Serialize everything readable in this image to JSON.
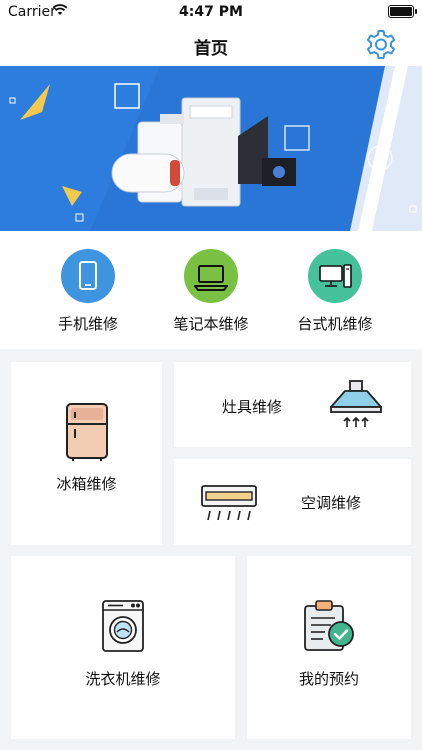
{
  "status_bar": {
    "carrier": "Carrier",
    "time": "4:47 PM"
  },
  "header": {
    "title": "首页"
  },
  "categories": [
    {
      "label": "手机维修",
      "color": "#3f94e0",
      "icon": "phone-icon"
    },
    {
      "label": "笔记本维修",
      "color": "#7ac043",
      "icon": "laptop-icon"
    },
    {
      "label": "台式机维修",
      "color": "#45c29a",
      "icon": "desktop-icon"
    }
  ],
  "services": {
    "fridge": "冰箱维修",
    "stove": "灶具维修",
    "ac": "空调维修",
    "washer": "洗衣机维修",
    "appointment": "我的预约"
  },
  "colors": {
    "accent": "#3f94e0",
    "banner": "#2a76d6"
  }
}
